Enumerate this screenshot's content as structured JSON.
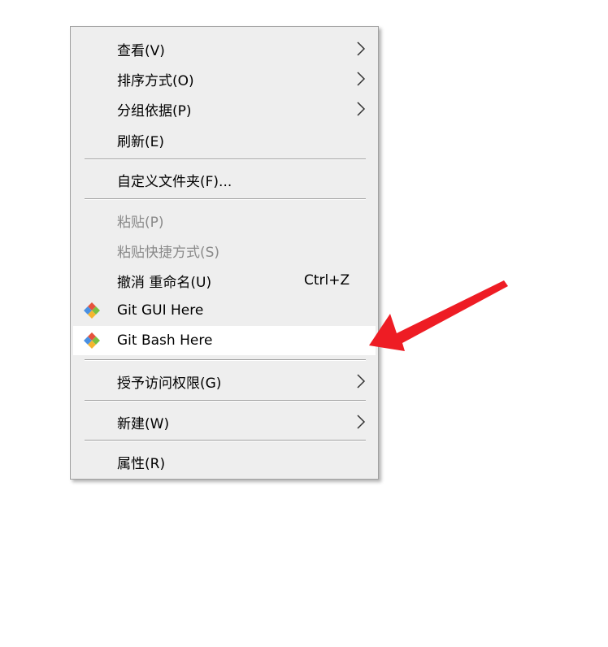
{
  "menu": {
    "items": [
      {
        "label": "查看(V)"
      },
      {
        "label": "排序方式(O)"
      },
      {
        "label": "分组依据(P)"
      },
      {
        "label": "刷新(E)"
      },
      {
        "label": "自定义文件夹(F)..."
      },
      {
        "label": "粘贴(P)"
      },
      {
        "label": "粘贴快捷方式(S)"
      },
      {
        "label": "撤消 重命名(U)",
        "shortcut": "Ctrl+Z"
      },
      {
        "label": "Git GUI Here",
        "icon": "git-gui-icon"
      },
      {
        "label": "Git Bash Here",
        "icon": "git-bash-icon"
      },
      {
        "label": "授予访问权限(G)"
      },
      {
        "label": "新建(W)"
      },
      {
        "label": "属性(R)"
      }
    ]
  },
  "annotation": {
    "arrow_color": "#ee1c24",
    "points_to": "Git Bash Here"
  },
  "colors": {
    "menu_bg": "#eeeeee",
    "highlight_bg": "#ffffff",
    "disabled_text": "#8a8a8a"
  }
}
